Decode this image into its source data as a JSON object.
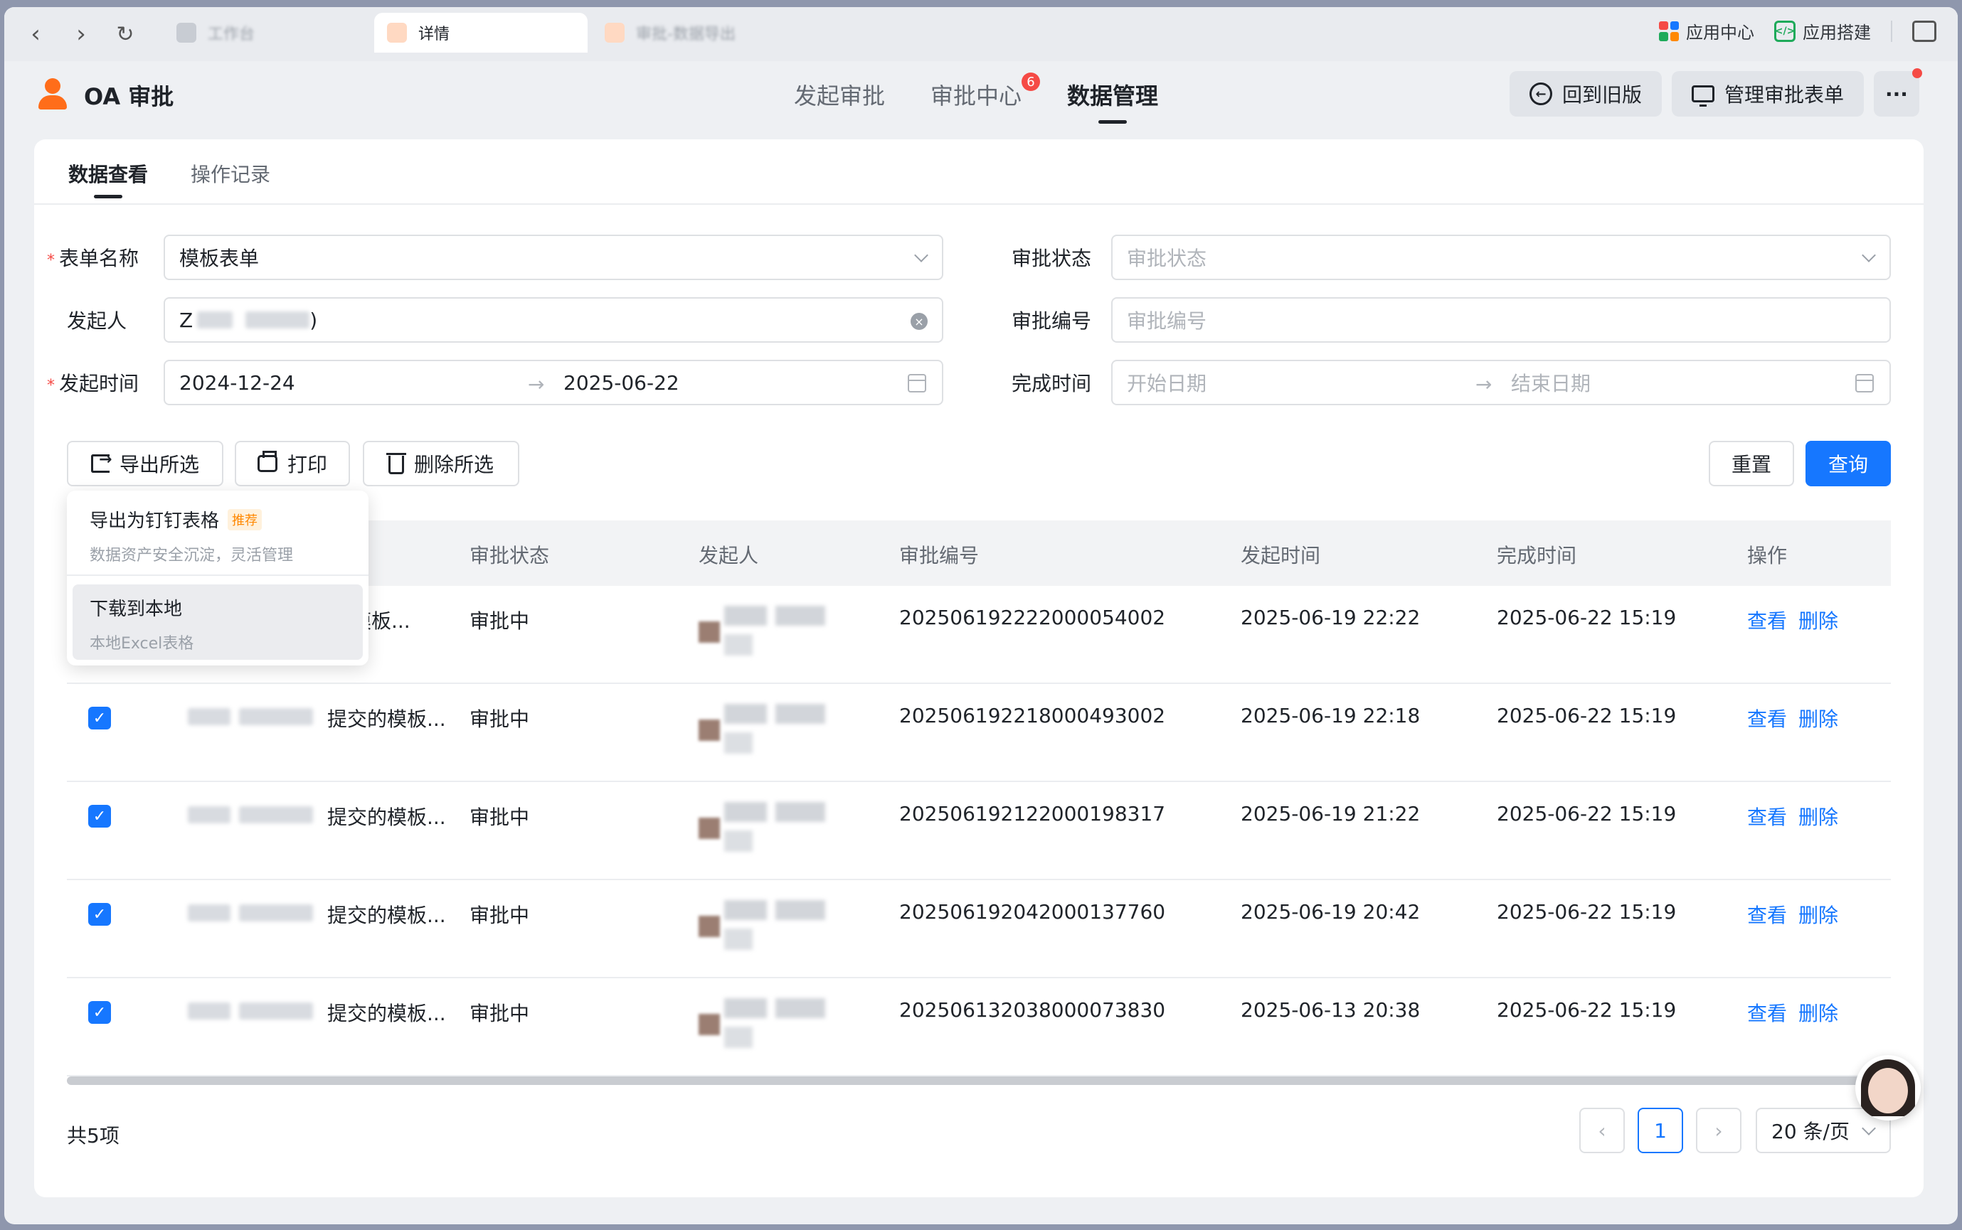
{
  "browser": {
    "tabs": [
      {
        "label": "工作台",
        "active": false
      },
      {
        "label": "详情",
        "active": true
      },
      {
        "label": "审批-数据导出",
        "active": false
      }
    ],
    "right": {
      "app_center": "应用中心",
      "app_build": "应用搭建"
    }
  },
  "header": {
    "app_title": "OA 审批",
    "nav": [
      {
        "label": "发起审批"
      },
      {
        "label": "审批中心",
        "badge": "6"
      },
      {
        "label": "数据管理",
        "active": true
      }
    ],
    "back_old": "回到旧版",
    "manage_forms": "管理审批表单",
    "more": "···"
  },
  "subtabs": [
    "数据查看",
    "操作记录"
  ],
  "filters": {
    "form_name_label": "表单名称",
    "form_name_value": "模板表单",
    "status_label": "审批状态",
    "status_placeholder": "审批状态",
    "initiator_label": "发起人",
    "initiator_prefix": "Z",
    "initiator_suffix": ")",
    "number_label": "审批编号",
    "number_placeholder": "审批编号",
    "start_time_label": "发起时间",
    "start_from": "2024-12-24",
    "start_to": "2025-06-22",
    "finish_time_label": "完成时间",
    "finish_from_placeholder": "开始日期",
    "finish_to_placeholder": "结束日期",
    "range_arrow": "→"
  },
  "toolbar": {
    "export": "导出所选",
    "print": "打印",
    "delete": "删除所选",
    "reset": "重置",
    "query": "查询"
  },
  "export_menu": {
    "dingtalk_title": "导出为钉钉表格",
    "dingtalk_tag": "推荐",
    "dingtalk_desc": "数据资产安全沉淀，灵活管理",
    "local_title": "下载到本地",
    "local_desc": "本地Excel表格"
  },
  "table": {
    "columns": [
      "审批状态",
      "发起人",
      "审批编号",
      "发起时间",
      "完成时间",
      "操作"
    ],
    "view": "查看",
    "remove": "删除",
    "rows": [
      {
        "title": "模板...",
        "status": "审批中",
        "number": "202506192222000054002",
        "start": "2025-06-19 22:22",
        "end": "2025-06-22 15:19"
      },
      {
        "title": "提交的模板...",
        "status": "审批中",
        "number": "202506192218000493002",
        "start": "2025-06-19 22:18",
        "end": "2025-06-22 15:19"
      },
      {
        "title": "提交的模板...",
        "status": "审批中",
        "number": "202506192122000198317",
        "start": "2025-06-19 21:22",
        "end": "2025-06-22 15:19"
      },
      {
        "title": "提交的模板...",
        "status": "审批中",
        "number": "202506192042000137760",
        "start": "2025-06-19 20:42",
        "end": "2025-06-22 15:19"
      },
      {
        "title": "提交的模板...",
        "status": "审批中",
        "number": "202506132038000073830",
        "start": "2025-06-13 20:38",
        "end": "2025-06-22 15:19"
      }
    ]
  },
  "pagination": {
    "total": "共5项",
    "prev": "‹",
    "page": "1",
    "next": "›",
    "page_size": "20 条/页"
  }
}
